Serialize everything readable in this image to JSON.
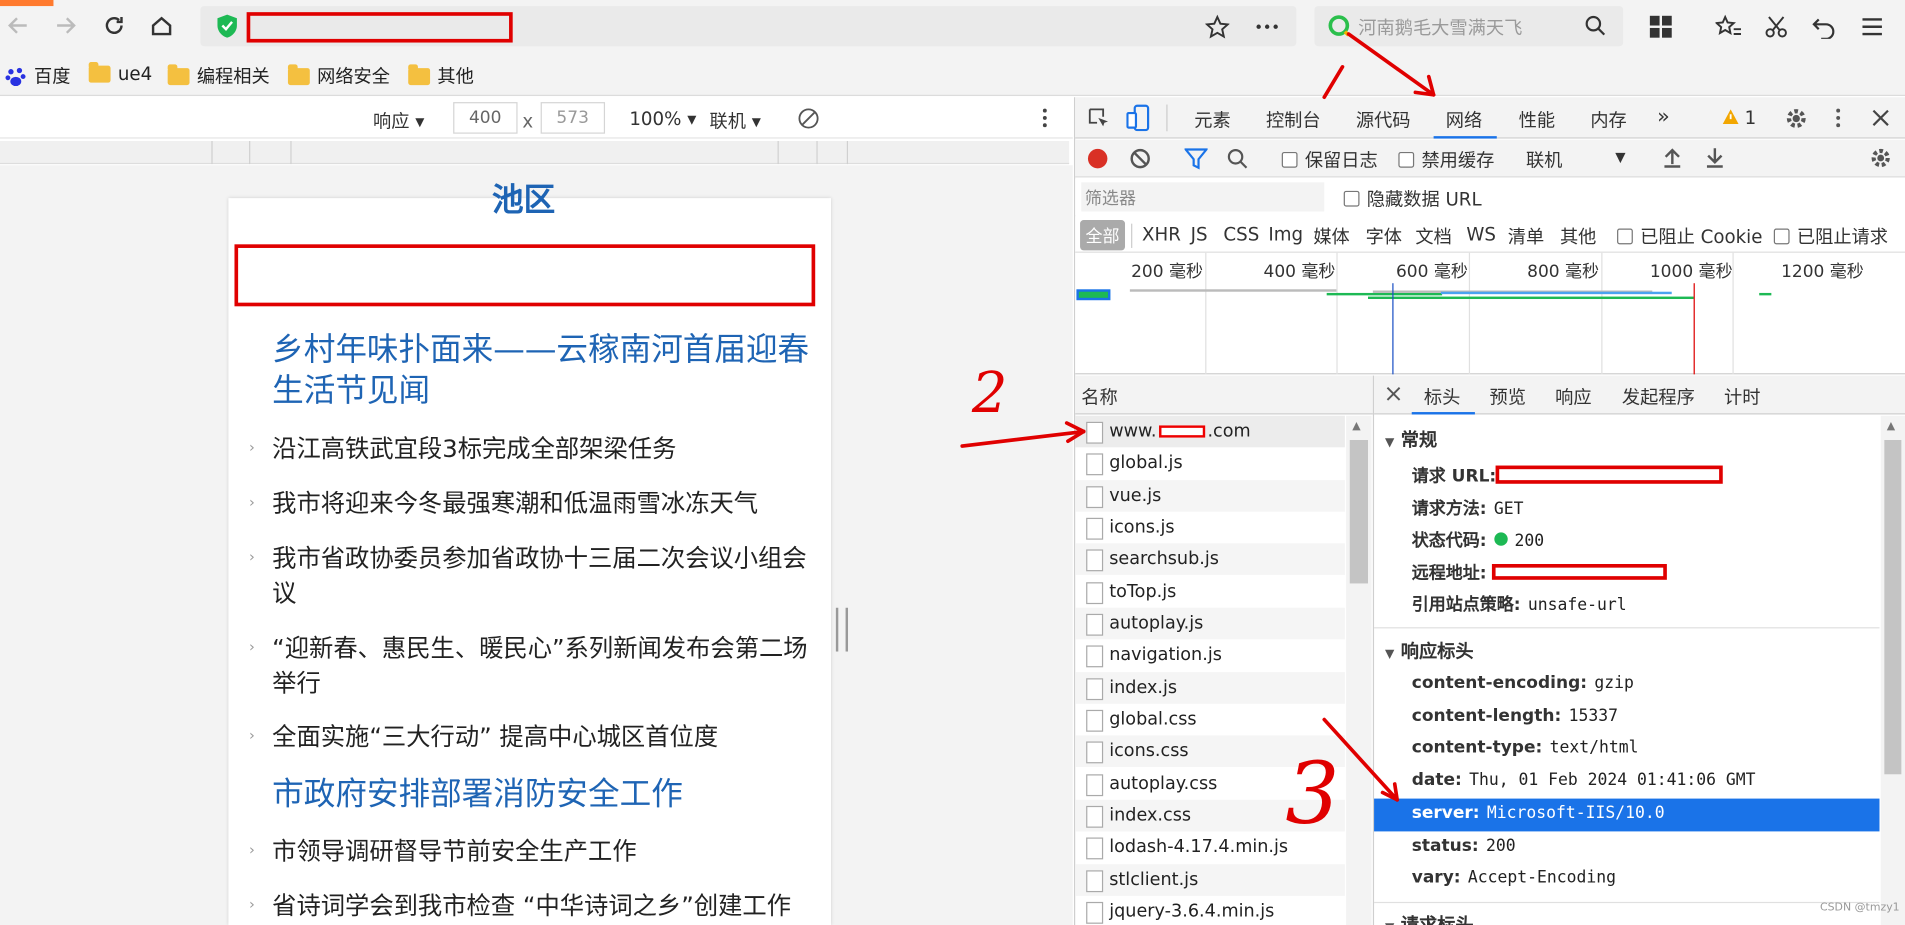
{
  "browser": {
    "search_placeholder": "河南鹅毛大雪满天飞",
    "bookmarks": [
      "百度",
      "ue4",
      "编程相关",
      "网络安全",
      "其他"
    ]
  },
  "emulator": {
    "mode": "响应",
    "width": "400",
    "times": "x",
    "height": "573",
    "zoom": "100%",
    "network": "联机"
  },
  "page": {
    "top_cut": "池区",
    "headline1": "乡村年味扑面来——云稼南河首届迎春生活节见闻",
    "items1": [
      "沿江高铁武宜段3标完成全部架梁任务",
      "我市将迎来今冬最强寒潮和低温雨雪冰冻天气",
      "我市省政协委员参加省政协十三届二次会议小组会议",
      "“迎新春、惠民生、暖民心”系列新闻发布会第二场举行",
      "全面实施“三大行动” 提高中心城区首位度"
    ],
    "headline2": "市政府安排部署消防安全工作",
    "items2": [
      "市领导调研督导节前安全生产工作",
      "省诗词学会到我市检查 “中华诗词之乡”创建工作"
    ]
  },
  "devtools": {
    "tabs": [
      "元素",
      "控制台",
      "源代码",
      "网络",
      "性能",
      "内存"
    ],
    "active_tab": "网络",
    "more": "»",
    "warn_count": "1",
    "toolbar": {
      "preserve_log": "保留日志",
      "disable_cache": "禁用缓存",
      "throttle": "联机"
    },
    "filter_placeholder": "筛选器",
    "hide_data_url": "隐藏数据 URL",
    "types": [
      "全部",
      "XHR",
      "JS",
      "CSS",
      "Img",
      "媒体",
      "字体",
      "文档",
      "WS",
      "清单",
      "其他"
    ],
    "blocked_cookies": "已阻止 Cookie",
    "blocked_requests": "已阻止请求",
    "timeline_ticks": [
      "200 毫秒",
      "400 毫秒",
      "600 毫秒",
      "800 毫秒",
      "1000 毫秒",
      "1200 毫秒"
    ],
    "list_header": "名称",
    "requests": [
      {
        "name_prefix": "www.",
        "name_suffix": ".com"
      },
      {
        "name": "global.js"
      },
      {
        "name": "vue.js"
      },
      {
        "name": "icons.js"
      },
      {
        "name": "searchsub.js"
      },
      {
        "name": "toTop.js"
      },
      {
        "name": "autoplay.js"
      },
      {
        "name": "navigation.js"
      },
      {
        "name": "index.js"
      },
      {
        "name": "global.css"
      },
      {
        "name": "icons.css"
      },
      {
        "name": "autoplay.css"
      },
      {
        "name": "index.css"
      },
      {
        "name": "lodash-4.17.4.min.js"
      },
      {
        "name": "stlclient.js"
      },
      {
        "name": "jquery-3.6.4.min.js"
      }
    ],
    "detail_tabs": [
      "标头",
      "预览",
      "响应",
      "发起程序",
      "计时"
    ],
    "general": {
      "title": "常规",
      "url_label": "请求 URL:",
      "method_label": "请求方法:",
      "method": "GET",
      "status_label": "状态代码:",
      "status": "200",
      "remote_label": "远程地址:",
      "referrer_label": "引用站点策略:",
      "referrer": "unsafe-url"
    },
    "response_headers": {
      "title": "响应标头",
      "rows": [
        {
          "k": "content-encoding:",
          "v": "gzip"
        },
        {
          "k": "content-length:",
          "v": "15337"
        },
        {
          "k": "content-type:",
          "v": "text/html"
        },
        {
          "k": "date:",
          "v": "Thu, 01 Feb 2024 01:41:06 GMT"
        },
        {
          "k": "server:",
          "v": "Microsoft-IIS/10.0"
        },
        {
          "k": "status:",
          "v": "200"
        },
        {
          "k": "vary:",
          "v": "Accept-Encoding"
        }
      ]
    },
    "request_headers_title": "请求标头"
  },
  "annotations": [
    "2",
    "3"
  ],
  "watermark": "CSDN @tmzy1",
  "colors": {
    "accent": "#1a73e8",
    "annotation": "#e00000",
    "link": "#1e64b4",
    "shield": "#1db954"
  }
}
